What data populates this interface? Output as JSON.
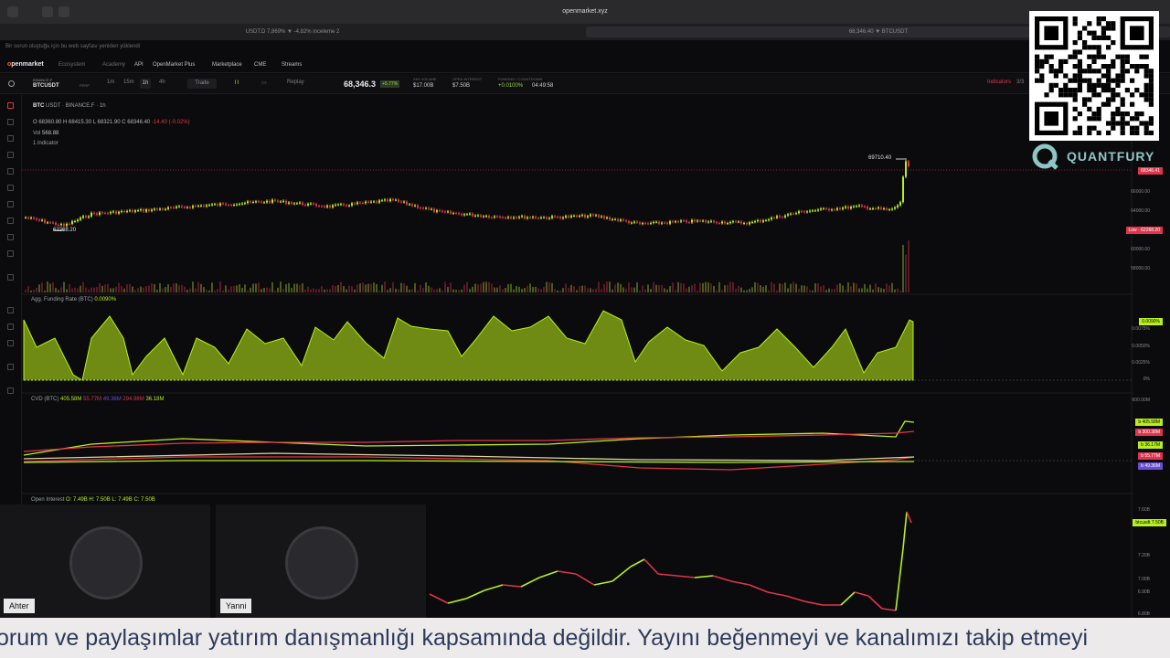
{
  "browser": {
    "url": "openmarket.xyz",
    "tab1": "USDT.D 7,869% ▼ -4.82% inceleme 2",
    "tab2": "68,346.40 ▼ BTCUSDT"
  },
  "notice": "Bir sorun oluştuğu için bu web sayfası yeniden yüklendi",
  "nav": {
    "brand_o": "o",
    "brand_rest": "penmarket",
    "items": [
      "Ecosystem",
      "Academy",
      "API",
      "OpenMarket Plus",
      "Marketplace",
      "CME",
      "Streams"
    ]
  },
  "toolbar": {
    "exchange": "BINANCE.F",
    "symbol": "BTCUSDT",
    "perp": "PERP",
    "timeframes": [
      "1m",
      "15m",
      "1h",
      "4h"
    ],
    "trade": "Trade",
    "replay": "Replay",
    "price": "68,346.3",
    "change": "+5.77%",
    "stats": [
      {
        "label": "24H VOLUME",
        "value": "$17.00B"
      },
      {
        "label": "OPEN INTEREST",
        "value": "$7.50B"
      },
      {
        "label": "FUNDING / COUNTDOWN",
        "value": "+0.0100%"
      },
      {
        "label": "",
        "value": "04:49:58"
      }
    ],
    "indicators": "Indicators",
    "indicators_count": "3/3"
  },
  "main": {
    "title": "BTC",
    "quote": "USDT",
    "exch": "BINANCE.F",
    "tf": "1h",
    "o": "68360.80",
    "h": "68415.30",
    "l": "68321.90",
    "c": "68346.40",
    "chg": "-14.40 (-0.02%)",
    "vol_label": "Vol",
    "vol": "568.88",
    "indicator_count": "1 indicator",
    "high_label": "69710.40",
    "low_label": "62268.20",
    "axis": [
      "66000.00",
      "64000.00",
      "62000.00",
      "60000.00",
      "58000.00"
    ],
    "price_tag": "68346.41",
    "low_tag_prefix": "Low",
    "low_tag": "62268.20"
  },
  "funding": {
    "label": "Agg. Funding Rate (BTC)",
    "value": "0.0090%",
    "axis": [
      "0.0075%",
      "0.0050%",
      "0.0025%",
      "0%"
    ],
    "tag": "0.0090%"
  },
  "cvd": {
    "label": "CVD (BTC)",
    "items": [
      {
        "v": "405.58M",
        "color": "#b7f01a"
      },
      {
        "v": "55.77M",
        "color": "#e0344a"
      },
      {
        "v": "49.36M",
        "color": "#6b4cd6"
      },
      {
        "v": "294.98M",
        "color": "#e0344a"
      },
      {
        "v": "36.18M",
        "color": "#b7f01a"
      }
    ],
    "axis_top": "600.00M",
    "tags": [
      "405.58M",
      "300.38M",
      "36.17M",
      "55.77M",
      "49.36M"
    ],
    "tag_prefix": "b"
  },
  "oi": {
    "label": "Open Interest",
    "o": "O: 7.49B",
    "h": "H: 7.50B",
    "l": "L: 7.49B",
    "c": "C: 7.50B",
    "axis": [
      "7.60B",
      "7.40B",
      "7.20B",
      "7.00B",
      "6.90B",
      "6.80B"
    ],
    "tag_prefix": "btcusdt",
    "tag": "7.50B"
  },
  "branding": {
    "name": "QUANTFURY",
    "q": "Q"
  },
  "participants": [
    {
      "name": "Ahter"
    },
    {
      "name": "Yanni"
    }
  ],
  "ticker": "orum ve paylaşımlar yatırım danışmanlığı kapsamında değildir. Yayını beğenmeyi ve kanalımızı takip etmeyi"
}
